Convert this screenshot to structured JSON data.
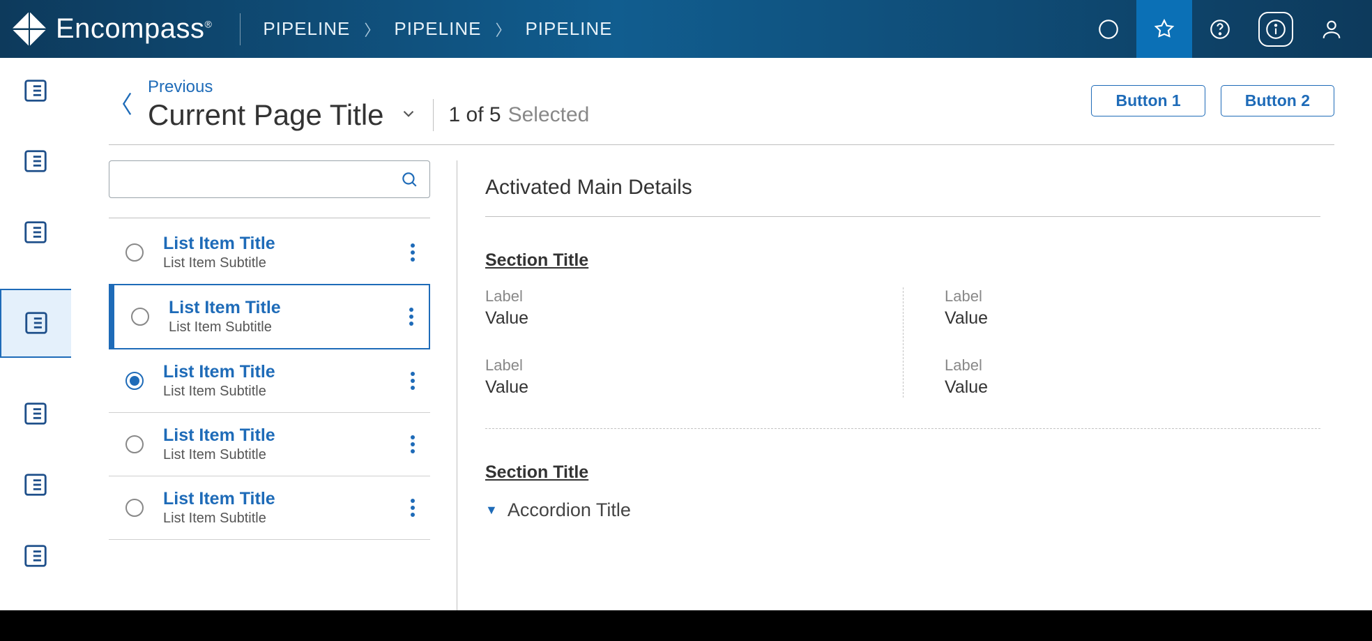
{
  "brand": "Encompass",
  "breadcrumbs": [
    "PIPELINE",
    "PIPELINE",
    "PIPELINE"
  ],
  "header": {
    "previous": "Previous",
    "title": "Current Page Title",
    "count": "1 of 5",
    "count_qualifier": "Selected",
    "buttons": [
      "Button 1",
      "Button 2"
    ]
  },
  "search": {
    "placeholder": ""
  },
  "list": [
    {
      "title": "List Item Title",
      "subtitle": "List Item Subtitle",
      "checked": false,
      "selected": false
    },
    {
      "title": "List Item Title",
      "subtitle": "List Item Subtitle",
      "checked": false,
      "selected": true
    },
    {
      "title": "List Item Title",
      "subtitle": "List Item Subtitle",
      "checked": true,
      "selected": false
    },
    {
      "title": "List Item Title",
      "subtitle": "List Item Subtitle",
      "checked": false,
      "selected": false
    },
    {
      "title": "List Item Title",
      "subtitle": "List Item Subtitle",
      "checked": false,
      "selected": false
    }
  ],
  "details": {
    "heading": "Activated Main Details",
    "section1": {
      "title": "Section Title",
      "fields": [
        {
          "label": "Label",
          "value": "Value"
        },
        {
          "label": "Label",
          "value": "Value"
        },
        {
          "label": "Label",
          "value": "Value"
        },
        {
          "label": "Label",
          "value": "Value"
        }
      ]
    },
    "section2": {
      "title": "Section Title",
      "accordion": "Accordion Title"
    }
  }
}
